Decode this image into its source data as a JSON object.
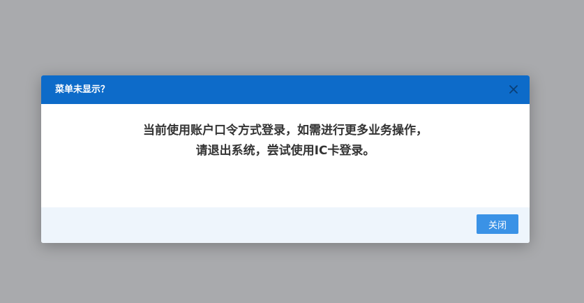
{
  "dialog": {
    "title": "菜单未显示？",
    "close_icon": "close-icon",
    "message": "当前使用账户口令方式登录，如需进行更多业务操作，请退出系统，尝试使用IC卡登录。",
    "close_button_label": "关闭"
  },
  "colors": {
    "backdrop": "#a9aaad",
    "header": "#0d6bc9",
    "footer": "#eef5fc",
    "button": "#3a92e6",
    "message_text": "#333333"
  }
}
